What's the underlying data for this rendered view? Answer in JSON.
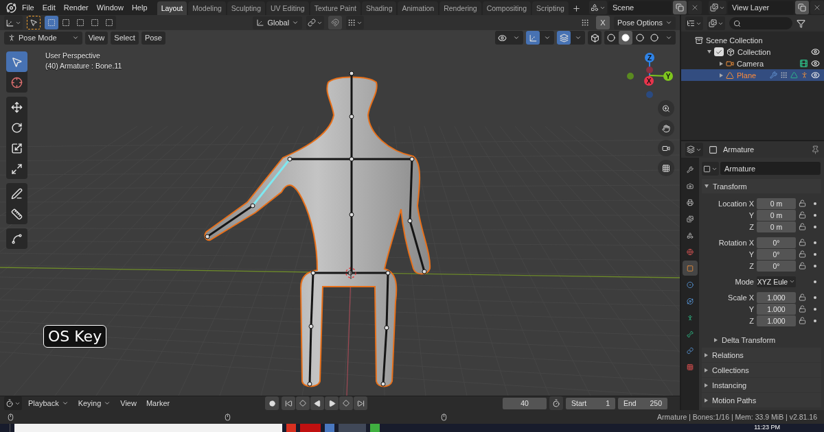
{
  "menu": [
    "File",
    "Edit",
    "Render",
    "Window",
    "Help"
  ],
  "workspaces": [
    {
      "label": "Layout",
      "selected": true
    },
    {
      "label": "Modeling",
      "selected": false
    },
    {
      "label": "Sculpting",
      "selected": false
    },
    {
      "label": "UV Editing",
      "selected": false
    },
    {
      "label": "Texture Paint",
      "selected": false
    },
    {
      "label": "Shading",
      "selected": false
    },
    {
      "label": "Animation",
      "selected": false
    },
    {
      "label": "Rendering",
      "selected": false
    },
    {
      "label": "Compositing",
      "selected": false
    },
    {
      "label": "Scripting",
      "selected": false
    }
  ],
  "scene": "Scene",
  "view_layer": "View Layer",
  "tool_header": {
    "select_modes": [
      {
        "selected": true
      },
      {
        "selected": false
      },
      {
        "selected": false
      },
      {
        "selected": false
      },
      {
        "selected": false
      }
    ],
    "orientation": "Global",
    "x_mirror": {
      "label": "X",
      "on": false
    },
    "pose_options": "Pose Options"
  },
  "viewport_header": {
    "mode": "Pose Mode",
    "menus": [
      "View",
      "Select",
      "Pose"
    ],
    "toggles": [
      {
        "kind": "visibility",
        "on": false
      },
      {
        "kind": "gizmo",
        "on": true
      },
      {
        "kind": "overlay",
        "on": true
      },
      {
        "kind": "xray",
        "on": false
      }
    ],
    "shading": [
      {
        "selected": false
      },
      {
        "selected": true
      },
      {
        "selected": false
      },
      {
        "selected": false
      }
    ]
  },
  "tool_groups": [
    [
      {
        "kind": "select",
        "selected": true
      },
      {
        "kind": "cursor",
        "selected": false
      }
    ],
    [
      {
        "kind": "move",
        "selected": false
      },
      {
        "kind": "rotate",
        "selected": false
      },
      {
        "kind": "scale",
        "selected": false
      },
      {
        "kind": "transform",
        "selected": false
      }
    ],
    [
      {
        "kind": "annotate",
        "selected": false
      },
      {
        "kind": "measure",
        "selected": false
      }
    ],
    [
      {
        "kind": "relax",
        "selected": false
      }
    ]
  ],
  "viewport": {
    "info": [
      "User Perspective",
      "(40) Armature : Bone.11"
    ],
    "axes": [
      {
        "label": "Z",
        "color": "#2f84e8"
      },
      {
        "label": "Y",
        "color": "#7fc61d"
      },
      {
        "label": "X",
        "color": "#e8344c"
      }
    ],
    "key_overlay": "OS Key"
  },
  "outliner": {
    "items": [
      {
        "label": "Scene Collection",
        "kind": "scene-collection",
        "children": [
          {
            "label": "Collection",
            "kind": "collection",
            "checked": true,
            "expanded": true,
            "children": [
              {
                "label": "Camera",
                "kind": "camera",
                "expanded": false,
                "selected": false
              },
              {
                "label": "Plane",
                "kind": "mesh",
                "expanded": false,
                "selected": true
              }
            ]
          }
        ]
      }
    ]
  },
  "properties": {
    "title": "Armature",
    "datablock": "Armature",
    "tabs": [
      {
        "kind": "tool",
        "selected": false
      },
      {
        "kind": "render",
        "selected": false
      },
      {
        "kind": "output",
        "selected": false
      },
      {
        "kind": "view-layer",
        "selected": false
      },
      {
        "kind": "scene",
        "selected": false
      },
      {
        "kind": "world",
        "selected": false
      },
      {
        "kind": "object",
        "selected": true
      },
      {
        "kind": "physics",
        "selected": false
      },
      {
        "kind": "constraints",
        "selected": false
      },
      {
        "kind": "armature",
        "selected": false
      },
      {
        "kind": "bone",
        "selected": false
      },
      {
        "kind": "bone-constraints",
        "selected": false
      },
      {
        "kind": "texture",
        "selected": false
      }
    ],
    "panels": [
      {
        "title": "Transform",
        "expanded": true,
        "groups": [
          [
            {
              "label": "Location X",
              "value": "0 m",
              "kind": "number"
            },
            {
              "label": "Y",
              "value": "0 m",
              "kind": "number"
            },
            {
              "label": "Z",
              "value": "0 m",
              "kind": "number"
            }
          ],
          [
            {
              "label": "Rotation X",
              "value": "0°",
              "kind": "number"
            },
            {
              "label": "Y",
              "value": "0°",
              "kind": "number"
            },
            {
              "label": "Z",
              "value": "0°",
              "kind": "number"
            }
          ],
          [
            {
              "label": "Mode",
              "value": "XYZ Eule",
              "kind": "dropdown"
            }
          ],
          [
            {
              "label": "Scale X",
              "value": "1.000",
              "kind": "number"
            },
            {
              "label": "Y",
              "value": "1.000",
              "kind": "number"
            },
            {
              "label": "Z",
              "value": "1.000",
              "kind": "number"
            }
          ]
        ],
        "subpanels": [
          {
            "title": "Delta Transform",
            "expanded": false
          }
        ]
      },
      {
        "title": "Relations",
        "expanded": false
      },
      {
        "title": "Collections",
        "expanded": false
      },
      {
        "title": "Instancing",
        "expanded": false
      },
      {
        "title": "Motion Paths",
        "expanded": false
      }
    ]
  },
  "timeline": {
    "menus": [
      {
        "label": "Playback",
        "dropdown": true
      },
      {
        "label": "Keying",
        "dropdown": true
      },
      {
        "label": "View",
        "dropdown": false
      },
      {
        "label": "Marker",
        "dropdown": false
      }
    ],
    "current_frame": "40",
    "start_label": "Start",
    "start": "1",
    "end_label": "End",
    "end": "250"
  },
  "status_bar": "Armature | Bones:1/16 | Mem: 33.9 MiB | v2.81.16",
  "taskbar": {
    "time": "11:23 PM"
  }
}
